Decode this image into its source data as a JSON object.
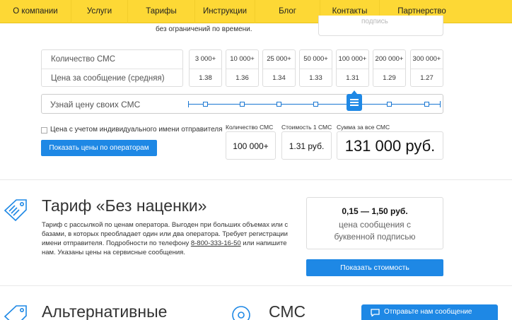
{
  "nav": {
    "items": [
      "О компании",
      "Услуги",
      "Тарифы",
      "Инструкции",
      "Блог",
      "Контакты",
      "Партнерство"
    ]
  },
  "top_fragment": {
    "text": "без ограничений по времени.",
    "card_stub_text": "подпись"
  },
  "price_table": {
    "row_labels": [
      "Количество СМС",
      "Цена за сообщение (средняя)"
    ],
    "columns": [
      {
        "qty": "3 000+",
        "price": "1.38"
      },
      {
        "qty": "10 000+",
        "price": "1.36"
      },
      {
        "qty": "25 000+",
        "price": "1.34"
      },
      {
        "qty": "50 000+",
        "price": "1.33"
      },
      {
        "qty": "100 000+",
        "price": "1.31"
      },
      {
        "qty": "200 000+",
        "price": "1.29"
      },
      {
        "qty": "300 000+",
        "price": "1.27"
      }
    ]
  },
  "slider": {
    "label": "Узнай цену своих СМС",
    "selected_index": 4
  },
  "options": {
    "individual_sender_label": "Цена с учетом индивидуального имени отправителя",
    "individual_sender_checked": false,
    "operators_button": "Показать цены по операторам"
  },
  "calculator": {
    "qty_label": "Количество СМС",
    "qty_value": "100 000+",
    "unit_label": "Стоимость 1 СМС",
    "unit_value": "1.31 руб.",
    "total_label": "Сумма за все СМС",
    "total_value": "131 000 руб."
  },
  "tariff": {
    "title": "Тариф «Без наценки»",
    "desc_before_phone": "Тариф с рассылкой по ценам оператора. Выгоден при больших объемах или с базами, в которых преобладает один или два оператора. Требует регистрации имени отправителя. Подробности по телефону ",
    "phone": "8-800-333-16-50",
    "desc_after_phone": " или напишите нам. Указаны цены на сервисные сообщения.",
    "price_range": "0,15 — 1,50 руб.",
    "price_sub_1": "цена сообщения с",
    "price_sub_2": "буквенной подписью",
    "button": "Показать стоимость"
  },
  "bottom": {
    "alt_title": "Альтернативные",
    "sms_title": "СМС"
  },
  "chat": {
    "label": "Отправьте нам сообщение"
  },
  "colors": {
    "nav_bg": "#fdd835",
    "accent": "#1e88e5"
  }
}
